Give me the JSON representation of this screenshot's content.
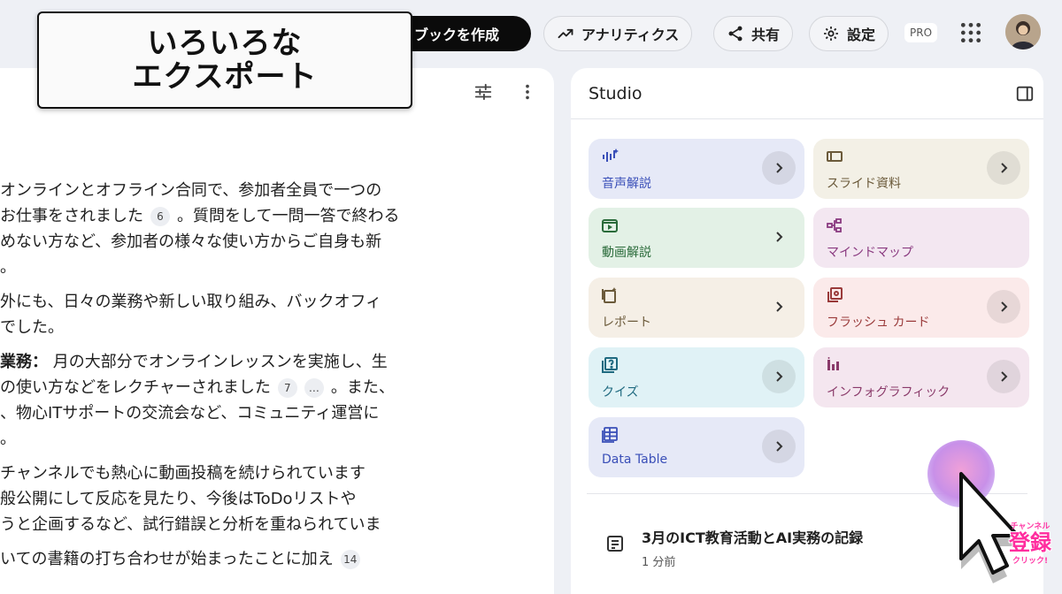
{
  "topbar": {
    "create_label": "ブックを作成",
    "analytics_label": "アナリティクス",
    "share_label": "共有",
    "settings_label": "設定",
    "pro_badge": "PRO"
  },
  "overlay": {
    "line1": "いろいろな",
    "line2": "エクスポート"
  },
  "notes": {
    "lines": [
      "オンラインとオフライン合同で、参加者全員で一つの",
      "お仕事をされました",
      "めない方など、参加者の様々な使い方からご自身も新",
      "。",
      "外にも、日々の業務や新しい取り組み、バックオフィ",
      "でした。",
      "月の大部分でオンラインレッスンを実施し、生",
      "の使い方などをレクチャーされました",
      "、物心ITサポートの交流会など、コミュニティ運営に",
      "。",
      "チャンネルでも熱心に動画投稿を続けられています",
      "般公開にして反応を見たり、今後はToDoリストや",
      "うと企画するなど、試行錯誤と分析を重ねられていま",
      "いての書籍の打ち合わせが始まったことに加え"
    ],
    "line2_suffix": "。質問をして一問一答で終わる",
    "line7_prefix": "業務：",
    "line8_suffix": "。また、",
    "cites": [
      "6",
      "7",
      "…",
      "14"
    ]
  },
  "studio": {
    "title": "Studio",
    "tiles": [
      {
        "label": "音声解説",
        "icon": "audio-wave-icon"
      },
      {
        "label": "スライド資料",
        "icon": "slides-icon"
      },
      {
        "label": "動画解説",
        "icon": "video-icon"
      },
      {
        "label": "マインドマップ",
        "icon": "mindmap-icon"
      },
      {
        "label": "レポート",
        "icon": "report-icon"
      },
      {
        "label": "フラッシュ カード",
        "icon": "flashcard-icon"
      },
      {
        "label": "クイズ",
        "icon": "quiz-icon"
      },
      {
        "label": "インフォグラフィック",
        "icon": "infographic-icon"
      },
      {
        "label": "Data Table",
        "icon": "table-icon"
      }
    ],
    "colors": {
      "audio": "#e6e9f7",
      "slides": "#f3f0e6",
      "video": "#e3f1e6",
      "mindmap": "#f3e7f1",
      "report": "#f5efe6",
      "flashcard": "#fbeaea",
      "quiz": "#e0f2f6",
      "infographic": "#f4e6ef",
      "table": "#e6e9f7"
    },
    "note": {
      "title": "3月のICT教育活動とAI実務の記録",
      "time": "1 分前"
    }
  },
  "subscribe": {
    "top": "チャンネル",
    "main": "登録",
    "bottom": "クリック!"
  }
}
